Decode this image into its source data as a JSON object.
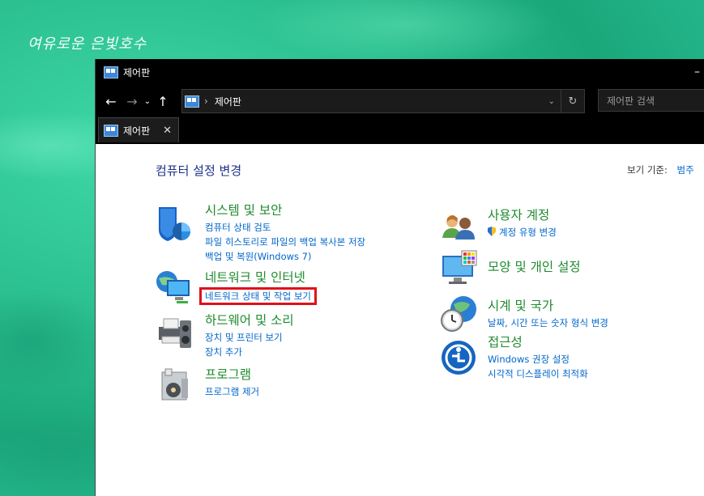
{
  "desktop": {
    "watermark": "여유로운 은빛호수"
  },
  "window": {
    "title": "제어판",
    "minimize": "–",
    "nav": {
      "back": "←",
      "forward": "→",
      "recent": "⌄",
      "up": "↑"
    },
    "address": {
      "crumb": "제어판",
      "separator": "›",
      "dropdown": "⌄",
      "refresh": "↻"
    },
    "search": {
      "placeholder": "제어판 검색"
    },
    "tab": {
      "label": "제어판",
      "close": "✕"
    }
  },
  "content": {
    "heading": "컴퓨터 설정 변경",
    "view_by_label": "보기 기준:",
    "view_by_value": "범주",
    "left_categories": [
      {
        "title": "시스템 및 보안",
        "icon": "shield-icon",
        "links": [
          "컴퓨터 상태 검토",
          "파일 히스토리로 파일의 백업 복사본 저장",
          "백업 및 복원(Windows 7)"
        ]
      },
      {
        "title": "네트워크 및 인터넷",
        "icon": "network-icon",
        "links": [
          "네트워크 상태 및 작업 보기"
        ]
      },
      {
        "title": "하드웨어 및 소리",
        "icon": "printer-icon",
        "links": [
          "장치 및 프린터 보기",
          "장치 추가"
        ]
      },
      {
        "title": "프로그램",
        "icon": "programs-icon",
        "links": [
          "프로그램 제거"
        ]
      }
    ],
    "right_categories": [
      {
        "title": "사용자 계정",
        "icon": "users-icon",
        "links": [
          "계정 유형 변경"
        ]
      },
      {
        "title": "모양 및 개인 설정",
        "icon": "monitor-icon",
        "links": []
      },
      {
        "title": "시계 및 국가",
        "icon": "clock-globe-icon",
        "links": [
          "날짜, 시간 또는 숫자 형식 변경"
        ]
      },
      {
        "title": "접근성",
        "icon": "accessibility-icon",
        "links": [
          "Windows 권장 설정",
          "시각적 디스플레이 최적화"
        ]
      }
    ],
    "highlight_color": "#e0101a"
  }
}
